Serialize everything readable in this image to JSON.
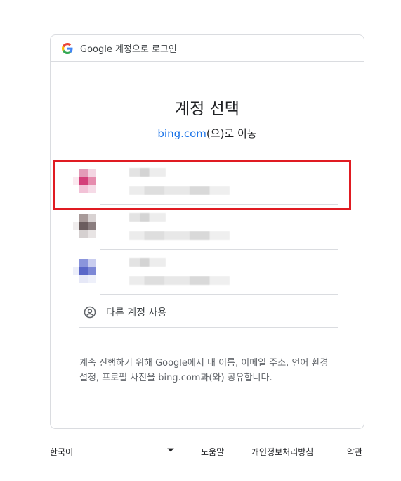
{
  "header": {
    "brand_text": "Google 계정으로 로그인"
  },
  "main": {
    "title": "계정 선택",
    "subtitle_link": "bing.com",
    "subtitle_rest": "(으)로 이동",
    "use_other_label": "다른 계정 사용",
    "notice": "계속 진행하기 위해 Google에서 내 이름, 이메일 주소, 언어 환경설정, 프로필 사진을 bing.com과(와) 공유합니다."
  },
  "accounts": [
    {
      "avatar_colors": [
        "#e39bb8",
        "#d43f7a",
        "#f2c2d7"
      ]
    },
    {
      "avatar_colors": [
        "#a89a99",
        "#6b5d5e",
        "#d5d0d0"
      ]
    },
    {
      "avatar_colors": [
        "#8b95dc",
        "#5a67c8",
        "#e6e8f7"
      ]
    }
  ],
  "footer": {
    "language": "한국어",
    "help": "도움말",
    "privacy": "개인정보처리방침",
    "terms": "약관"
  },
  "colors": {
    "link": "#1a73e8",
    "highlight": "#e01b22",
    "border": "#dadce0"
  }
}
